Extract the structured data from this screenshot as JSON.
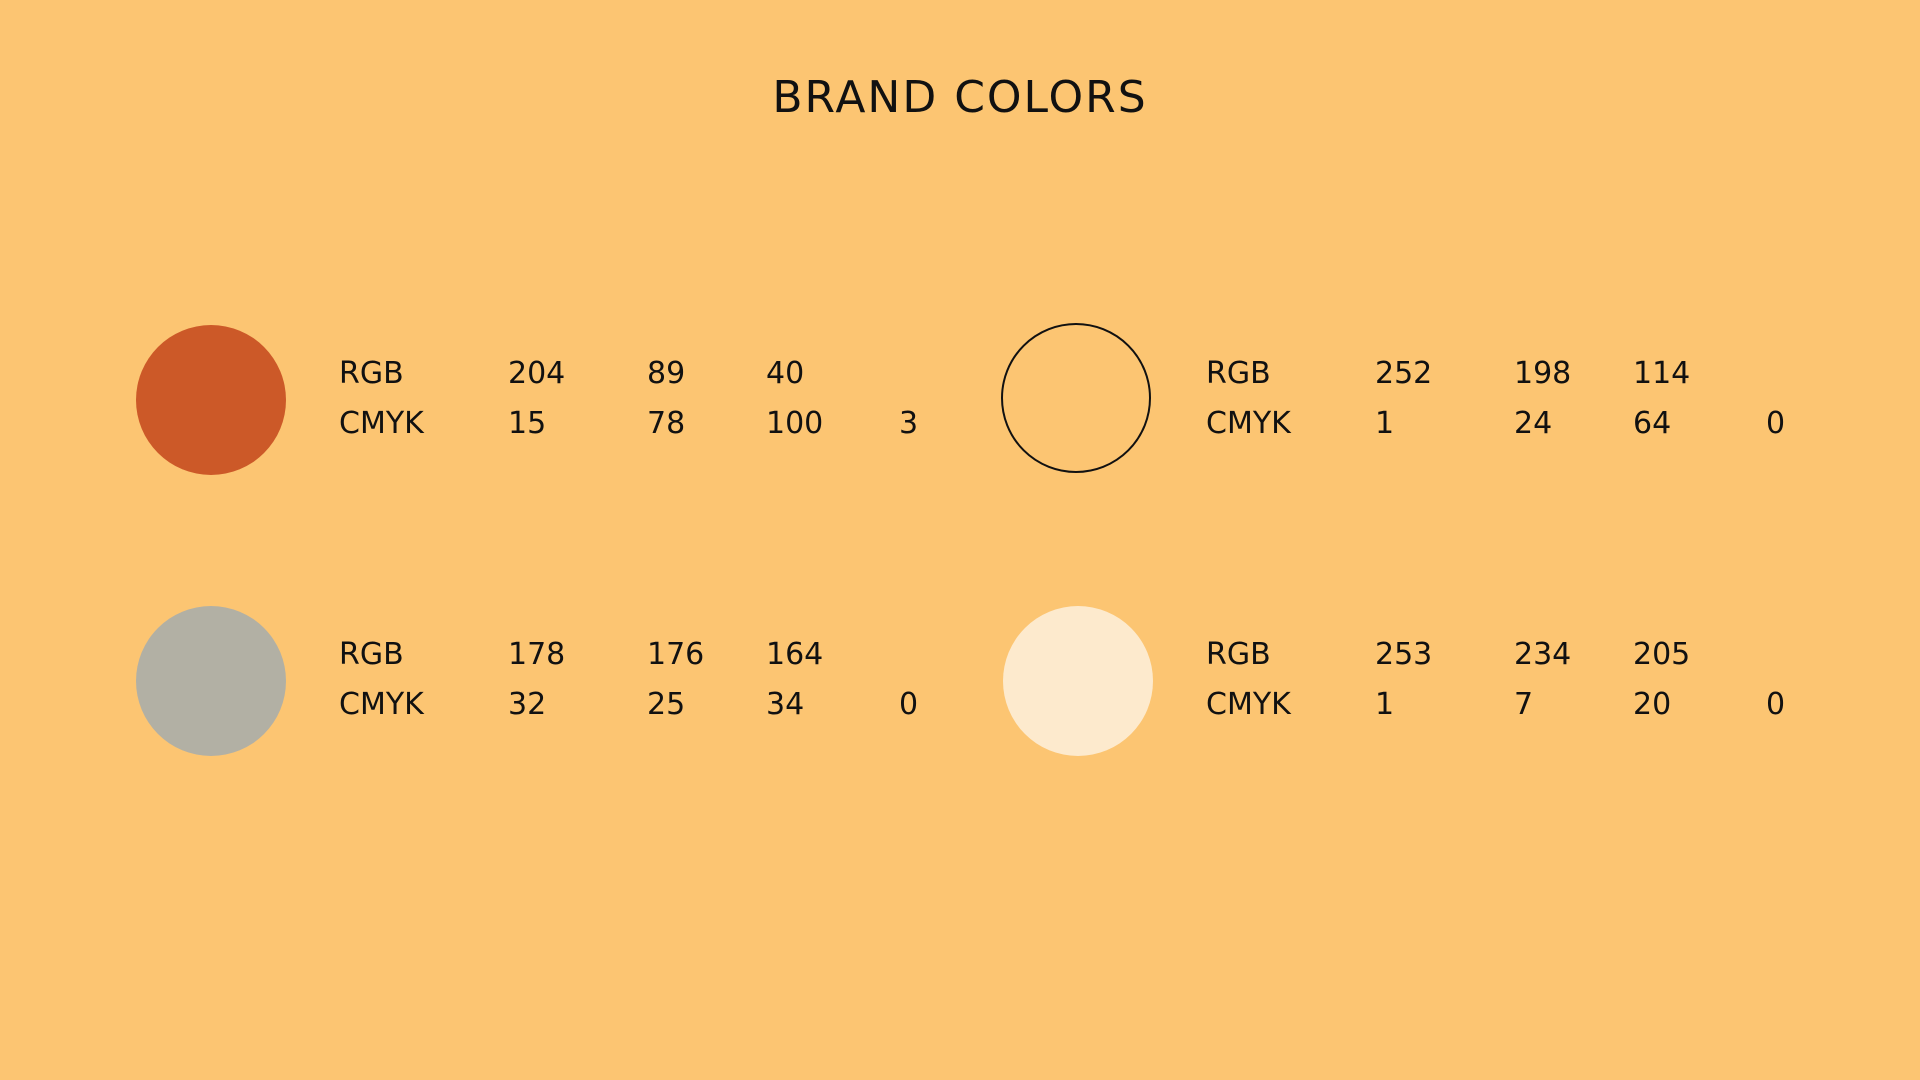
{
  "title": "BRAND COLORS",
  "colors": [
    {
      "swatch_color": "#CC5928",
      "swatch_style": "filled",
      "rgb_label": "RGB",
      "rgb": [
        "204",
        "89",
        "40"
      ],
      "cmyk_label": "CMYK",
      "cmyk": [
        "15",
        "78",
        "100",
        "3"
      ]
    },
    {
      "swatch_color": "#FCC672",
      "swatch_style": "outlined",
      "rgb_label": "RGB",
      "rgb": [
        "252",
        "198",
        "114"
      ],
      "cmyk_label": "CMYK",
      "cmyk": [
        "1",
        "24",
        "64",
        "0"
      ]
    },
    {
      "swatch_color": "#B2B0A4",
      "swatch_style": "filled",
      "rgb_label": "RGB",
      "rgb": [
        "178",
        "176",
        "164"
      ],
      "cmyk_label": "CMYK",
      "cmyk": [
        "32",
        "25",
        "34",
        "0"
      ]
    },
    {
      "swatch_color": "#FDEACD",
      "swatch_style": "filled",
      "rgb_label": "RGB",
      "rgb": [
        "253",
        "234",
        "205"
      ],
      "cmyk_label": "CMYK",
      "cmyk": [
        "1",
        "7",
        "20",
        "0"
      ]
    }
  ]
}
